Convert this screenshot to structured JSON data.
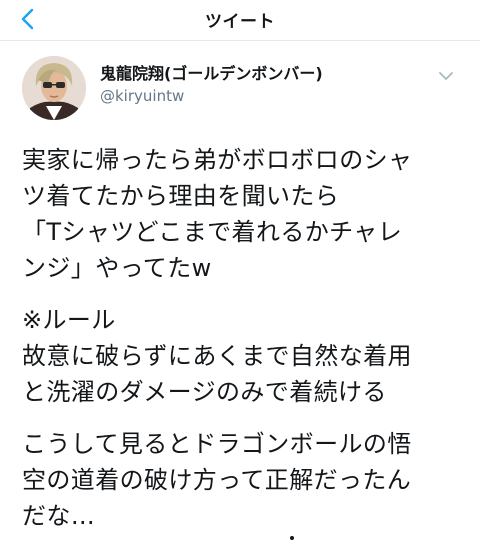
{
  "nav": {
    "back_icon": "chevron-left-icon",
    "title": "ツイート"
  },
  "author": {
    "display_name": "鬼龍院翔(ゴールデンボンバー)",
    "handle": "@kiryuintw",
    "avatar_icon": "avatar-photo"
  },
  "menu": {
    "caret_icon": "chevron-down-icon"
  },
  "tweet": {
    "paragraphs": [
      {
        "lines": [
          "実家に帰ったら弟がボロボロのシャ",
          "ツ着てたから理由を聞いたら",
          "「Tシャツどこまで着れるかチャレ",
          "ンジ」やってたw"
        ]
      },
      {
        "lines": [
          "※ルール",
          "故意に破らずにあくまで自然な着用",
          "と洗濯のダメージのみで着続ける"
        ]
      },
      {
        "lines": [
          "こうして見るとドラゴンボールの悟",
          "空の道着の破け方って正解だったん",
          "だな…"
        ]
      }
    ]
  },
  "colors": {
    "accent": "#1da1f2",
    "text": "#14171a",
    "secondary": "#657786",
    "divider": "#e6e9ec"
  }
}
